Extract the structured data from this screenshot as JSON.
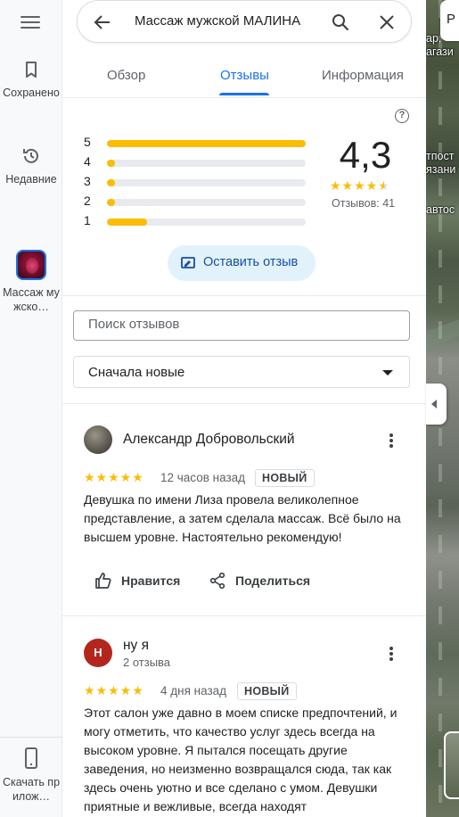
{
  "rail": {
    "saved_label": "Сохранено",
    "recent_label": "Недавние",
    "place_label": "Массаж мужско…",
    "download_label": "Скачать прилож…"
  },
  "search": {
    "query": "Массаж мужской МАЛИНА"
  },
  "tabs": [
    {
      "label": "Обзор"
    },
    {
      "label": "Отзывы"
    },
    {
      "label": "Информация"
    }
  ],
  "rating": {
    "average": "4,3",
    "count_text": "Отзывов: 41",
    "distribution": [
      {
        "stars": "5",
        "fraction": 1.0
      },
      {
        "stars": "4",
        "fraction": 0.04
      },
      {
        "stars": "3",
        "fraction": 0.04
      },
      {
        "stars": "2",
        "fraction": 0.04
      },
      {
        "stars": "1",
        "fraction": 0.2
      }
    ]
  },
  "write_review_label": "Оставить отзыв",
  "review_search": {
    "placeholder": "Поиск отзывов"
  },
  "sort": {
    "selected": "Сначала новые"
  },
  "reviews": [
    {
      "author": "Александр Добровольский",
      "subtitle": "",
      "stars": "★★★★★",
      "when": "12 часов назад",
      "badge": "НОВЫЙ",
      "text": "Девушка по имени Лиза провела великолепное представление, а затем сделала массаж. Всё было на высшем уровне. Настоятельно рекомендую!",
      "like_label": "Нравится",
      "share_label": "Поделиться"
    },
    {
      "author": "ну я",
      "avatar_letter": "Н",
      "subtitle": "2 отзыва",
      "stars": "★★★★★",
      "when": "4 дня назад",
      "badge": "НОВЫЙ",
      "text": "Этот салон уже давно в моем списке предпочтений, и могу отметить, что качество услуг здесь всегда на высоком уровне. Я пытался посещать другие заведения, но неизменно возвращался сюда, так как здесь очень уютно и все сделано с умом. Девушки приятные и вежливые, всегда находят"
    }
  ],
  "map": {
    "top_label": "Р",
    "labels": [
      "ар,",
      "агази",
      "тпост",
      "язани",
      "автос"
    ]
  },
  "colors": {
    "accent": "#1a73e8",
    "star": "#fbbc04",
    "avatar_letter_bg": "#b3261e"
  }
}
